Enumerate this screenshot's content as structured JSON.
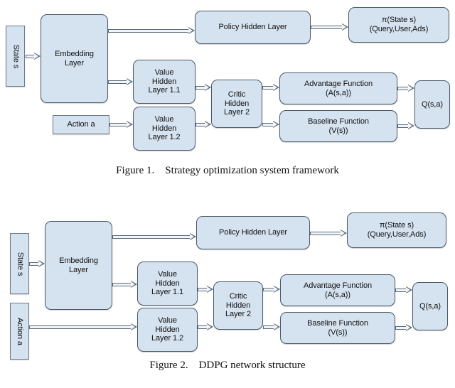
{
  "document": {
    "background_color": "#ffffff",
    "node_fill_color": "#d5e2f0",
    "node_border_color": "#4a5a6a",
    "arrow_color": "#5b6a78"
  },
  "figures": [
    {
      "id": "figure-1",
      "caption": "Figure 1.    Strategy optimization system framework",
      "nodes": {
        "state": "State s",
        "embedding": [
          "Embedding",
          "Layer"
        ],
        "policy_hidden": [
          "Policy Hidden Layer"
        ],
        "pi_output": [
          "π(State s)",
          "(Query,User,Ads)"
        ],
        "value_hidden_1_1": [
          "Value",
          "Hidden",
          "Layer 1.1"
        ],
        "action": "Action a",
        "value_hidden_1_2": [
          "Value",
          "Hidden",
          "Layer 1.2"
        ],
        "critic_hidden_2": [
          "Critic",
          "Hidden",
          "Layer 2"
        ],
        "advantage": [
          "Advantage Function",
          "(A(s,a))"
        ],
        "baseline": [
          "Baseline Function",
          "(V(s))"
        ],
        "q_output": [
          "Q(s,a)"
        ]
      }
    },
    {
      "id": "figure-2",
      "caption": "Figure 2.    DDPG network structure",
      "nodes": {
        "state": "State s",
        "embedding": [
          "Embedding",
          "Layer"
        ],
        "policy_hidden": [
          "Policy Hidden Layer"
        ],
        "pi_output": [
          "π(State s)",
          "(Query,User,Ads)"
        ],
        "value_hidden_1_1": [
          "Value",
          "Hidden",
          "Layer 1.1"
        ],
        "action": "Action a",
        "value_hidden_1_2": [
          "Value",
          "Hidden",
          "Layer 1.2"
        ],
        "critic_hidden_2": [
          "Critic",
          "Hidden",
          "Layer 2"
        ],
        "advantage": [
          "Advantage Function",
          "(A(s,a))"
        ],
        "baseline": [
          "Baseline Function",
          "(V(s))"
        ],
        "q_output": [
          "Q(s,a)"
        ]
      }
    }
  ]
}
